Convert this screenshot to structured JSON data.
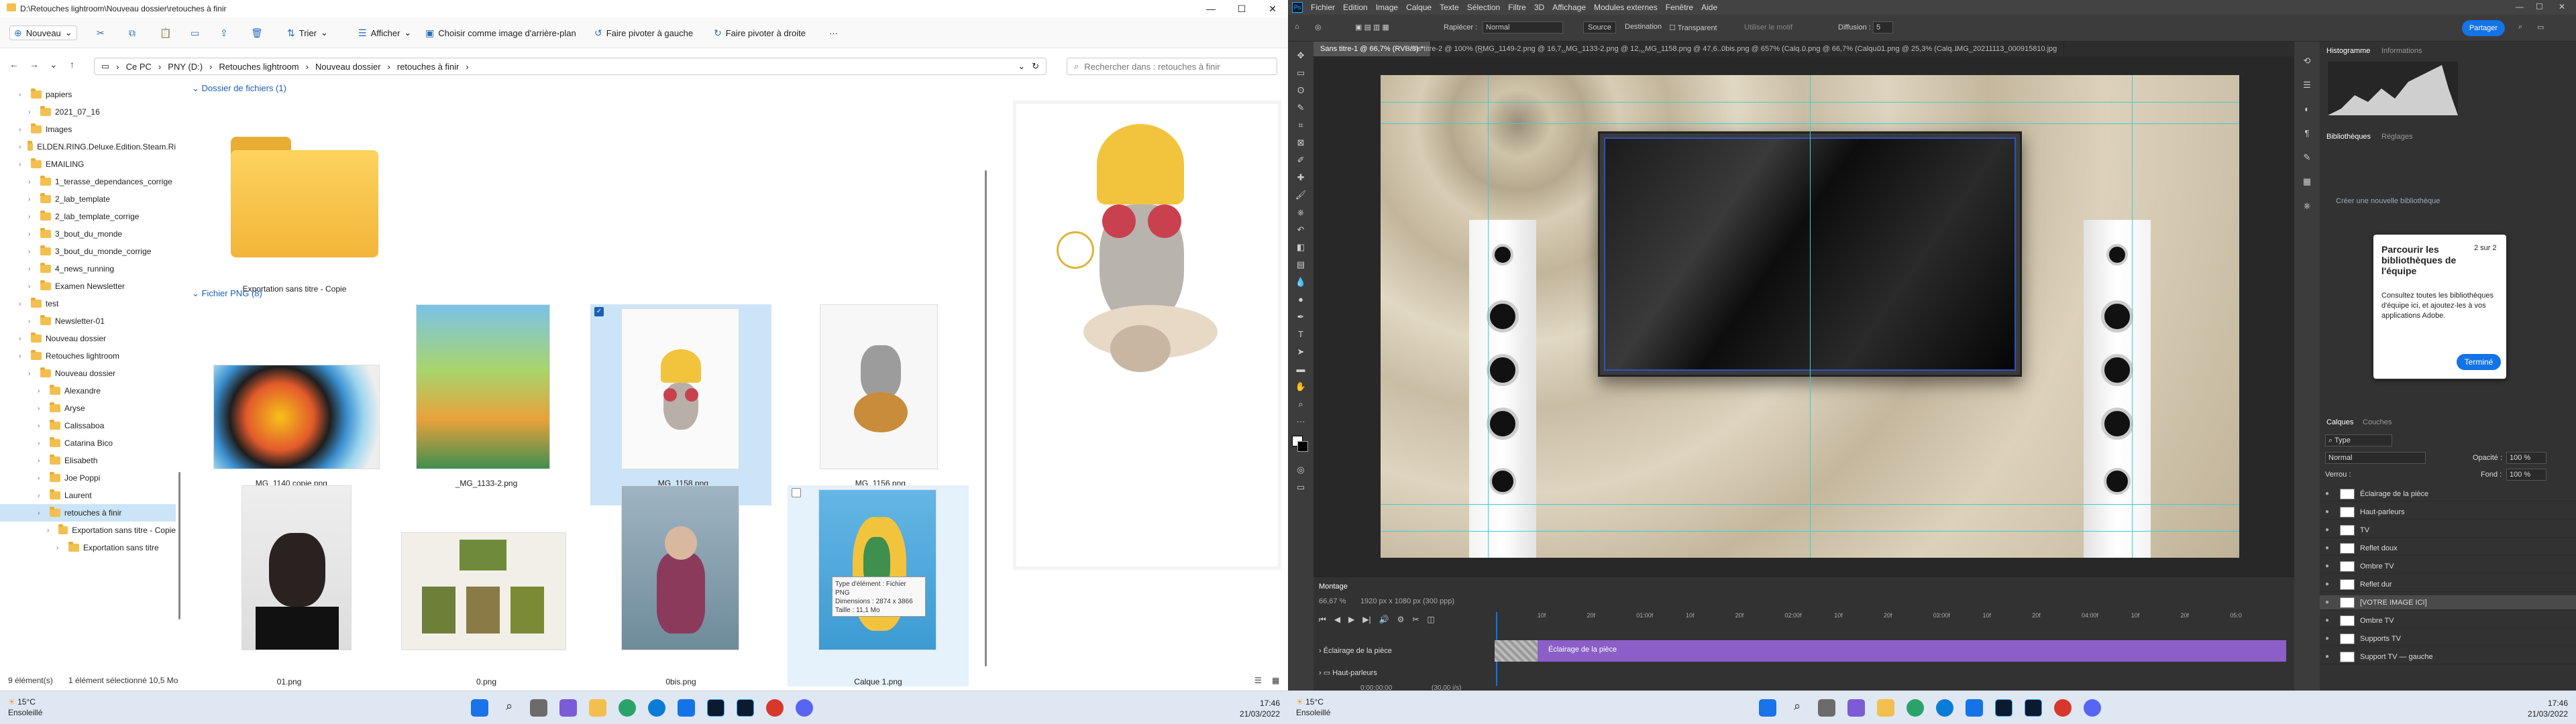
{
  "explorer": {
    "title": "D:\\Retouches lightroom\\Nouveau dossier\\retouches à finir",
    "ribbon": {
      "new": "Nouveau",
      "sort": "Trier",
      "view": "Afficher",
      "wallpaper": "Choisir comme image d'arrière-plan",
      "rotate_left": "Faire pivoter à gauche",
      "rotate_right": "Faire pivoter à droite"
    },
    "breadcrumb": [
      "Ce PC",
      "PNY (D:)",
      "Retouches lightroom",
      "Nouveau dossier",
      "retouches à finir"
    ],
    "search_placeholder": "Rechercher dans : retouches à finir",
    "tree": [
      {
        "label": "papiers",
        "indent": 2
      },
      {
        "label": "2021_07_16",
        "indent": 3
      },
      {
        "label": "Images",
        "indent": 2
      },
      {
        "label": "ELDEN.RING.Deluxe.Edition.Steam.Ri",
        "indent": 2
      },
      {
        "label": "EMAILING",
        "indent": 2
      },
      {
        "label": "1_terasse_dependances_corrige",
        "indent": 3
      },
      {
        "label": "2_lab_template",
        "indent": 3
      },
      {
        "label": "2_lab_template_corrige",
        "indent": 3
      },
      {
        "label": "3_bout_du_monde",
        "indent": 3
      },
      {
        "label": "3_bout_du_monde_corrige",
        "indent": 3
      },
      {
        "label": "4_news_running",
        "indent": 3
      },
      {
        "label": "Examen Newsletter",
        "indent": 3
      },
      {
        "label": "test",
        "indent": 2
      },
      {
        "label": "Newsletter-01",
        "indent": 3
      },
      {
        "label": "Nouveau dossier",
        "indent": 2
      },
      {
        "label": "Retouches lightroom",
        "indent": 2
      },
      {
        "label": "Nouveau dossier",
        "indent": 3
      },
      {
        "label": "Alexandre",
        "indent": 4
      },
      {
        "label": "Aryse",
        "indent": 4
      },
      {
        "label": "Calissaboa",
        "indent": 4
      },
      {
        "label": "Catarina Bico",
        "indent": 4
      },
      {
        "label": "Elisabeth",
        "indent": 4
      },
      {
        "label": "Joe Poppi",
        "indent": 4
      },
      {
        "label": "Laurent",
        "indent": 4
      },
      {
        "label": "retouches à finir",
        "indent": 4
      },
      {
        "label": "Exportation sans titre - Copie",
        "indent": 5
      },
      {
        "label": "Exportation sans titre",
        "indent": 6
      }
    ],
    "group_folders": "Dossier de fichiers (1)",
    "folder_name": "Exportation sans titre - Copie",
    "group_png": "Fichier PNG (8)",
    "files": [
      {
        "name": "_MG_1140 copie.png"
      },
      {
        "name": "_MG_1133-2.png"
      },
      {
        "name": "_MG_1158.png"
      },
      {
        "name": "_MG_1156.png"
      },
      {
        "name": "01.png"
      },
      {
        "name": "0.png"
      },
      {
        "name": "0bis.png"
      },
      {
        "name": "Calque 1.png"
      }
    ],
    "tooltip": [
      "Type d'élément : Fichier PNG",
      "Dimensions : 2874 x 3866",
      "Taille : 11,1 Mo"
    ],
    "status": {
      "count": "9 élément(s)",
      "selection": "1 élément sélectionné  10,5 Mo"
    }
  },
  "taskbar_left": {
    "temp": "15°C",
    "weather": "Ensoleillé",
    "time": "17:46",
    "date": "21/03/2022"
  },
  "photoshop": {
    "menu": [
      "Fichier",
      "Edition",
      "Image",
      "Calque",
      "Texte",
      "Sélection",
      "Filtre",
      "3D",
      "Affichage",
      "Modules externes",
      "Fenêtre",
      "Aide"
    ],
    "options": {
      "patch": "Rapiécer :",
      "mode": "Normal",
      "source": "Source",
      "destination": "Destination",
      "transparent": "Transparent",
      "pattern": "Utiliser le motif",
      "diffusion": "Diffusion :",
      "diffusion_val": "5",
      "share": "Partager"
    },
    "tabs": [
      "Sans titre-1 @ 66,7% (RVB/8) *",
      "Sans titre-2 @ 100% (R...",
      "_MG_1149-2.png @ 16,7...",
      "_MG_1133-2.png @ 12,...",
      "_MG_1158.png @ 47,6...",
      "0bis.png @ 657% (Calq...",
      "0.png @ 66,7% (Calqu...",
      "01.png @ 25,3% (Calq...",
      "IMG_20211113_000915810.jpg"
    ],
    "right": {
      "histogram": "Histogramme",
      "info": "Informations",
      "libraries": "Bibliothèques",
      "adjust": "Réglages",
      "create_lib": "Créer une nouvelle bibliothèque",
      "layers": "Calques",
      "channels": "Couches",
      "filter_type": "Type",
      "blend": "Normal",
      "opacity_label": "Opacité :",
      "opacity": "100 %",
      "lock": "Verrou :",
      "fill_label": "Fond :",
      "fill": "100 %",
      "layers_list": [
        {
          "name": "Éclairage de la pièce"
        },
        {
          "name": "Haut-parleurs"
        },
        {
          "name": "TV"
        },
        {
          "name": "Reflet doux"
        },
        {
          "name": "Ombre TV"
        },
        {
          "name": "Reflet dur"
        },
        {
          "name": "[VOTRE IMAGE ICI]"
        },
        {
          "name": "Ombre TV"
        },
        {
          "name": "Supports TV"
        },
        {
          "name": "Support TV — gauche"
        }
      ]
    },
    "tip": {
      "title": "Parcourir les bibliothèques de l'équipe",
      "page": "2 sur 2",
      "body": "Consultez toutes les bibliothèques d'équipe ici, et ajoutez-les à vos applications Adobe.",
      "button": "Terminé"
    },
    "status": {
      "zoom": "66,67 %",
      "dims": "1920 px x 1080 px (300 ppp)"
    },
    "timeline": {
      "title": "Montage",
      "time": "0:00:00:00",
      "fps": "(30,00 i/s)",
      "tracks": [
        "Éclairage de la pièce",
        "Haut-parleurs"
      ],
      "clip": "Éclairage de la pièce",
      "ticks": [
        "10f",
        "20f",
        "01:00f",
        "10f",
        "20f",
        "02:00f",
        "10f",
        "20f",
        "03:00f",
        "10f",
        "20f",
        "04:00f",
        "10f",
        "20f",
        "05:0"
      ]
    }
  },
  "taskbar_right": {
    "temp": "15°C",
    "weather": "Ensoleillé",
    "time": "17:46",
    "date": "21/03/2022"
  },
  "colors": {
    "accent": "#1473e6",
    "folder": "#f3c04f",
    "select": "#cce4f7",
    "clip": "#8b5fc7"
  }
}
